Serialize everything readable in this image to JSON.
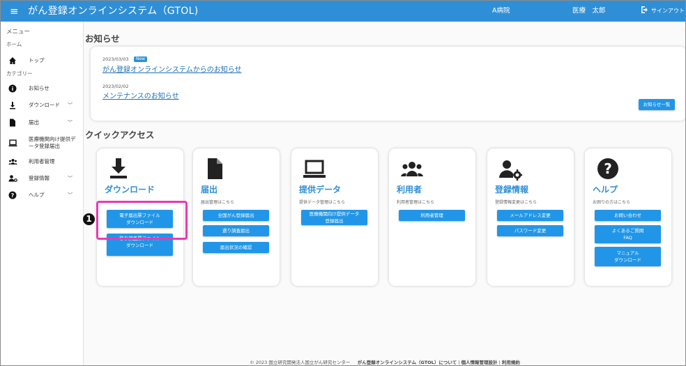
{
  "header": {
    "app_title": "がん登録オンラインシステム（GTOL)",
    "hospital": "A病院",
    "user": "医療　太郎",
    "signout": "サインアウト"
  },
  "sidebar": {
    "menu_heading": "メニュー",
    "home_heading": "ホーム",
    "top": "トップ",
    "category_heading": "カテゴリー",
    "items": [
      {
        "label": "お知らせ"
      },
      {
        "label": "ダウンロード"
      },
      {
        "label": "届出"
      },
      {
        "label": "医療機関向け提供デ\nータ登録届出"
      },
      {
        "label": "利用者管理"
      },
      {
        "label": "登録情報"
      },
      {
        "label": "ヘルプ"
      }
    ]
  },
  "news": {
    "heading": "お知らせ",
    "items": [
      {
        "date": "2023/03/03",
        "badge": "New",
        "title": "がん登録オンラインシステムからのお知らせ"
      },
      {
        "date": "2023/02/02",
        "title": "メンテナンスのお知らせ"
      }
    ],
    "list_button": "お知らせ一覧"
  },
  "quick_access": {
    "heading": "クイックアクセス",
    "cards": [
      {
        "title": "ダウンロード",
        "subtitle": "",
        "buttons": [
          "電子届出票ファイル\nダウンロード",
          "移り調査票ファイル\nダウンロード"
        ]
      },
      {
        "title": "届出",
        "subtitle": "届出管理はこちら",
        "buttons": [
          "全国がん登録届出",
          "遡り調査届出",
          "届出状況の確認"
        ]
      },
      {
        "title": "提供データ",
        "subtitle": "提供データ管理はこちら",
        "buttons": [
          "医療機関向け提供データ\n登録届出"
        ]
      },
      {
        "title": "利用者",
        "subtitle": "利用者管理はこちら",
        "buttons": [
          "利用者管理"
        ]
      },
      {
        "title": "登録情報",
        "subtitle": "登録情報変更はこちら",
        "buttons": [
          "メールアドレス変更",
          "パスワード変更"
        ]
      },
      {
        "title": "ヘルプ",
        "subtitle": "お困りの方はこちら",
        "buttons": [
          "お問い合わせ",
          "よくあるご質問\nFAQ",
          "マニュアル\nダウンロード"
        ]
      }
    ]
  },
  "annotation": {
    "step_number": "1"
  },
  "footer": {
    "copyright": "© 2023 国立研究開発法人国立がん研究センター",
    "links": [
      "がん登録オンラインシステム（GTOL）について",
      "個人情報管理設計",
      "利用規約"
    ],
    "separator": "|"
  }
}
